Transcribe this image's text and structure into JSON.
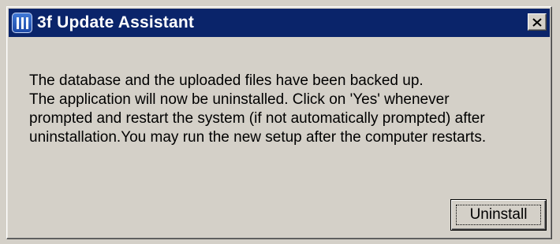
{
  "window": {
    "title": "3f Update Assistant",
    "title_bar_color": "#0a246a",
    "app_icon": "app-logo-icon",
    "close_icon": "close-icon"
  },
  "message": {
    "lines": [
      "The database and the uploaded files have been backed up.",
      "The application will now be uninstalled. Click on 'Yes' whenever",
      "prompted and restart the system (if not automatically prompted) after",
      "uninstallation.You may run the new setup after the computer restarts."
    ]
  },
  "buttons": {
    "uninstall_label": "Uninstall"
  }
}
